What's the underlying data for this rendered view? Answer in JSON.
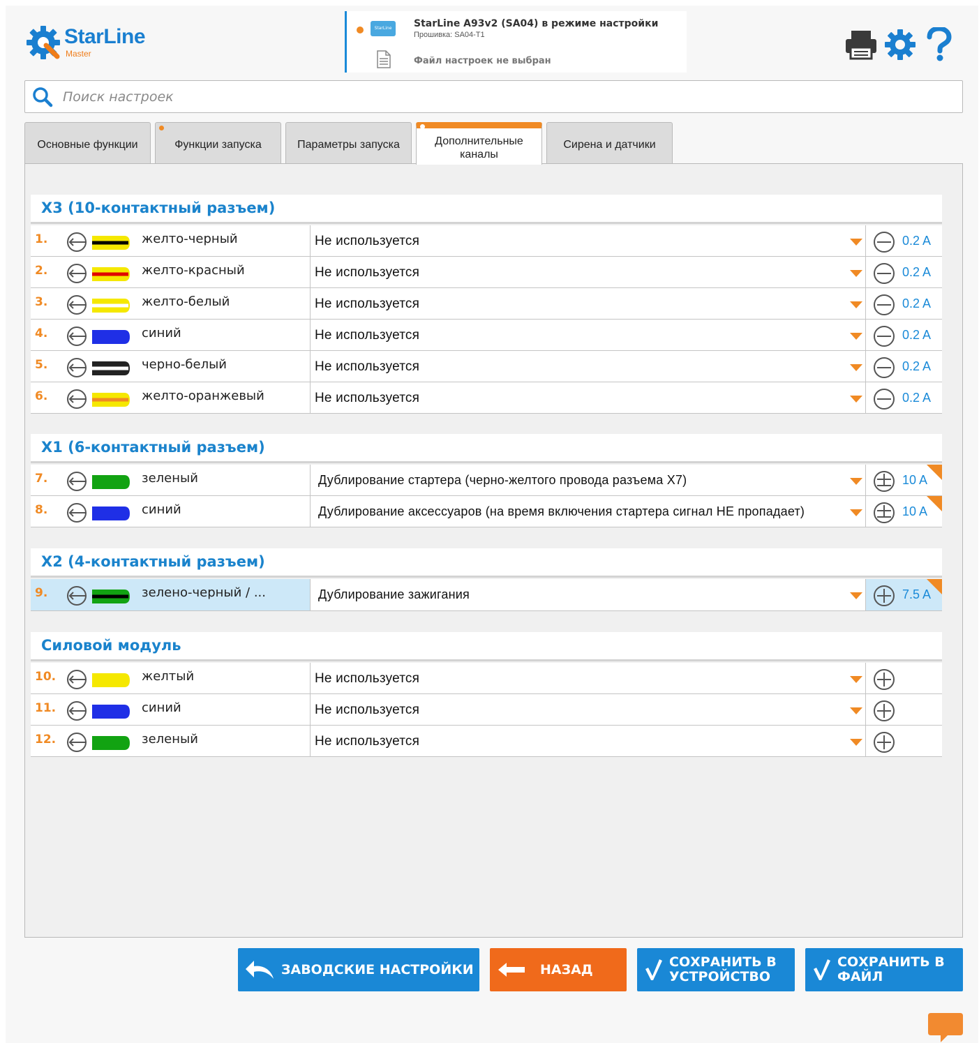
{
  "header": {
    "logo_name": "StarLine",
    "logo_sub": "Master",
    "device_title": "StarLine A93v2 (SA04) в режиме настройки",
    "firmware": "Прошивка: SA04-T1",
    "file_status": "Файл настроек не выбран",
    "chip_label": "StarLine"
  },
  "search": {
    "placeholder": "Поиск настроек",
    "value": ""
  },
  "tabs": [
    {
      "label": "Основные функции",
      "dot": false,
      "active": false
    },
    {
      "label": "Функции запуска",
      "dot": true,
      "active": false
    },
    {
      "label": "Параметры запуска",
      "dot": false,
      "active": false
    },
    {
      "label": "Дополнительные каналы",
      "dot": true,
      "active": true
    },
    {
      "label": "Сирена и датчики",
      "dot": false,
      "active": false
    }
  ],
  "sections": [
    {
      "title": "X3 (10-контактный разъем)",
      "rows": [
        {
          "num": "1.",
          "wire": "желто-черный",
          "wire_colors": [
            "#f5e800",
            "#000000"
          ],
          "func": "Не используется",
          "long": false,
          "amp_sign": "minus",
          "amp": "0.2 A",
          "corner": false,
          "highlight": false
        },
        {
          "num": "2.",
          "wire": "желто-красный",
          "wire_colors": [
            "#f5e800",
            "#e00000"
          ],
          "func": "Не используется",
          "long": false,
          "amp_sign": "minus",
          "amp": "0.2 A",
          "corner": false,
          "highlight": false
        },
        {
          "num": "3.",
          "wire": "желто-белый",
          "wire_colors": [
            "#f5e800",
            "#ffffff"
          ],
          "func": "Не используется",
          "long": false,
          "amp_sign": "minus",
          "amp": "0.2 A",
          "corner": false,
          "highlight": false
        },
        {
          "num": "4.",
          "wire": "синий",
          "wire_colors": [
            "#1f2fe6",
            "#1f2fe6"
          ],
          "func": "Не используется",
          "long": false,
          "amp_sign": "minus",
          "amp": "0.2 A",
          "corner": false,
          "highlight": false
        },
        {
          "num": "5.",
          "wire": "черно-белый",
          "wire_colors": [
            "#222222",
            "#ffffff"
          ],
          "func": "Не используется",
          "long": false,
          "amp_sign": "minus",
          "amp": "0.2 A",
          "corner": false,
          "highlight": false
        },
        {
          "num": "6.",
          "wire": "желто-оранжевый",
          "wire_colors": [
            "#f5e800",
            "#f08a24"
          ],
          "func": "Не используется",
          "long": false,
          "amp_sign": "minus",
          "amp": "0.2 A",
          "corner": false,
          "highlight": false
        }
      ]
    },
    {
      "title": "X1 (6-контактный разъем)",
      "rows": [
        {
          "num": "7.",
          "wire": "зеленый",
          "wire_colors": [
            "#12a312",
            "#12a312"
          ],
          "func": "Дублирование стартера (черно-желтого провода разъема X7)",
          "long": true,
          "amp_sign": "plusminus",
          "amp": "10 A",
          "corner": true,
          "highlight": false
        },
        {
          "num": "8.",
          "wire": "синий",
          "wire_colors": [
            "#1f2fe6",
            "#1f2fe6"
          ],
          "func": "Дублирование аксессуаров (на время включения стартера сигнал НЕ пропадает)",
          "long": true,
          "amp_sign": "plusminus",
          "amp": "10 A",
          "corner": true,
          "highlight": false
        }
      ]
    },
    {
      "title": "X2 (4-контактный разъем)",
      "rows": [
        {
          "num": "9.",
          "wire": "зелено-черный / ...",
          "wire_colors": [
            "#12a312",
            "#000000"
          ],
          "func": "Дублирование зажигания",
          "long": true,
          "amp_sign": "plus",
          "amp": "7.5 A",
          "corner": true,
          "highlight": true
        }
      ]
    },
    {
      "title": "Силовой модуль",
      "rows": [
        {
          "num": "10.",
          "wire": "желтый",
          "wire_colors": [
            "#f5e800",
            "#f5e800"
          ],
          "func": "Не используется",
          "long": false,
          "amp_sign": "plus",
          "amp": "",
          "corner": false,
          "highlight": false
        },
        {
          "num": "11.",
          "wire": "синий",
          "wire_colors": [
            "#1f2fe6",
            "#1f2fe6"
          ],
          "func": "Не используется",
          "long": false,
          "amp_sign": "plus",
          "amp": "",
          "corner": false,
          "highlight": false
        },
        {
          "num": "12.",
          "wire": "зеленый",
          "wire_colors": [
            "#12a312",
            "#12a312"
          ],
          "func": "Не используется",
          "long": false,
          "amp_sign": "plus",
          "amp": "",
          "corner": false,
          "highlight": false
        }
      ]
    }
  ],
  "buttons": {
    "factory": "ЗАВОДСКИЕ НАСТРОЙКИ",
    "back": "НАЗАД",
    "save_device": "СОХРАНИТЬ В УСТРОЙСТВО",
    "save_file": "СОХРАНИТЬ В ФАЙЛ"
  },
  "colors": {
    "accent_blue": "#1a88d6",
    "accent_orange": "#f08a24",
    "back_orange": "#f06a1b",
    "highlight_row": "#cde8f8"
  }
}
